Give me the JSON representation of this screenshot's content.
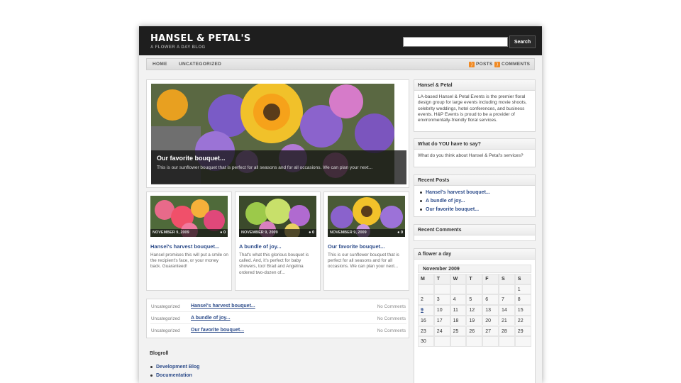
{
  "site": {
    "title": "HANSEL & PETAL'S",
    "tagline": "A FLOWER A DAY BLOG"
  },
  "search": {
    "placeholder": "",
    "button_label": "Search"
  },
  "nav": {
    "items": [
      "HOME",
      "UNCATEGORIZED"
    ],
    "feeds": [
      "POSTS",
      "COMMENTS"
    ]
  },
  "featured": {
    "title": "Our favorite bouquet...",
    "excerpt": "This is our sunflower bouquet that is perfect for all seasons and for all occasions. We can plan your next..."
  },
  "thumbs": [
    {
      "date": "NOVEMBER 9, 2009",
      "comments": "0",
      "title": "Hansel's harvest bouquet...",
      "excerpt": "Hansel promises this will put a smile on the recipient's face, or your money back. Guaranteed!"
    },
    {
      "date": "NOVEMBER 9, 2009",
      "comments": "0",
      "title": "A bundle of joy...",
      "excerpt": "That's what this glorious bouquet is called. And, it's perfect for baby showers, too! Brad and Angelina ordered two-dozen of..."
    },
    {
      "date": "NOVEMBER 9, 2009",
      "comments": "0",
      "title": "Our favorite bouquet...",
      "excerpt": "This is our sunflower bouquet that is perfect for all seasons and for all occasions. We can plan your next..."
    }
  ],
  "post_list": [
    {
      "category": "Uncategorized",
      "title": "Hansel's harvest bouquet...",
      "comments": "No Comments"
    },
    {
      "category": "Uncategorized",
      "title": "A bundle of joy...",
      "comments": "No Comments"
    },
    {
      "category": "Uncategorized",
      "title": "Our favorite bouquet...",
      "comments": "No Comments"
    }
  ],
  "blogroll": {
    "title": "Blogroll",
    "items": [
      "Development Blog",
      "Documentation"
    ]
  },
  "sidebar": {
    "about": {
      "title": "Hansel & Petal",
      "text": "LA-based Hansel & Petal Events is the premier floral design group for large events including movie shoots, celebrity weddings, hotel conferences, and business events. H&P Events is proud to be a provider of environmentally-friendly floral services."
    },
    "say": {
      "title": "What do YOU have to say?",
      "text": "What do you think about Hansel & Petal's services?"
    },
    "recent_posts": {
      "title": "Recent Posts",
      "items": [
        "Hansel's harvest bouquet...",
        "A bundle of joy...",
        "Our favorite bouquet..."
      ]
    },
    "recent_comments": {
      "title": "Recent Comments"
    },
    "calendar": {
      "title": "A flower a day",
      "caption": "November 2009",
      "days": [
        "M",
        "T",
        "W",
        "T",
        "F",
        "S",
        "S"
      ],
      "weeks": [
        [
          "",
          "",
          "",
          "",
          "",
          "",
          "1"
        ],
        [
          "2",
          "3",
          "4",
          "5",
          "6",
          "7",
          "8"
        ],
        [
          "9",
          "10",
          "11",
          "12",
          "13",
          "14",
          "15"
        ],
        [
          "16",
          "17",
          "18",
          "19",
          "20",
          "21",
          "22"
        ],
        [
          "23",
          "24",
          "25",
          "26",
          "27",
          "28",
          "29"
        ],
        [
          "30",
          "",
          "",
          "",
          "",
          "",
          ""
        ]
      ],
      "linked_day": "9"
    }
  },
  "colors": {
    "header": "#1e1e1e",
    "link": "#2d4c8a",
    "rss": "#f08a24"
  }
}
